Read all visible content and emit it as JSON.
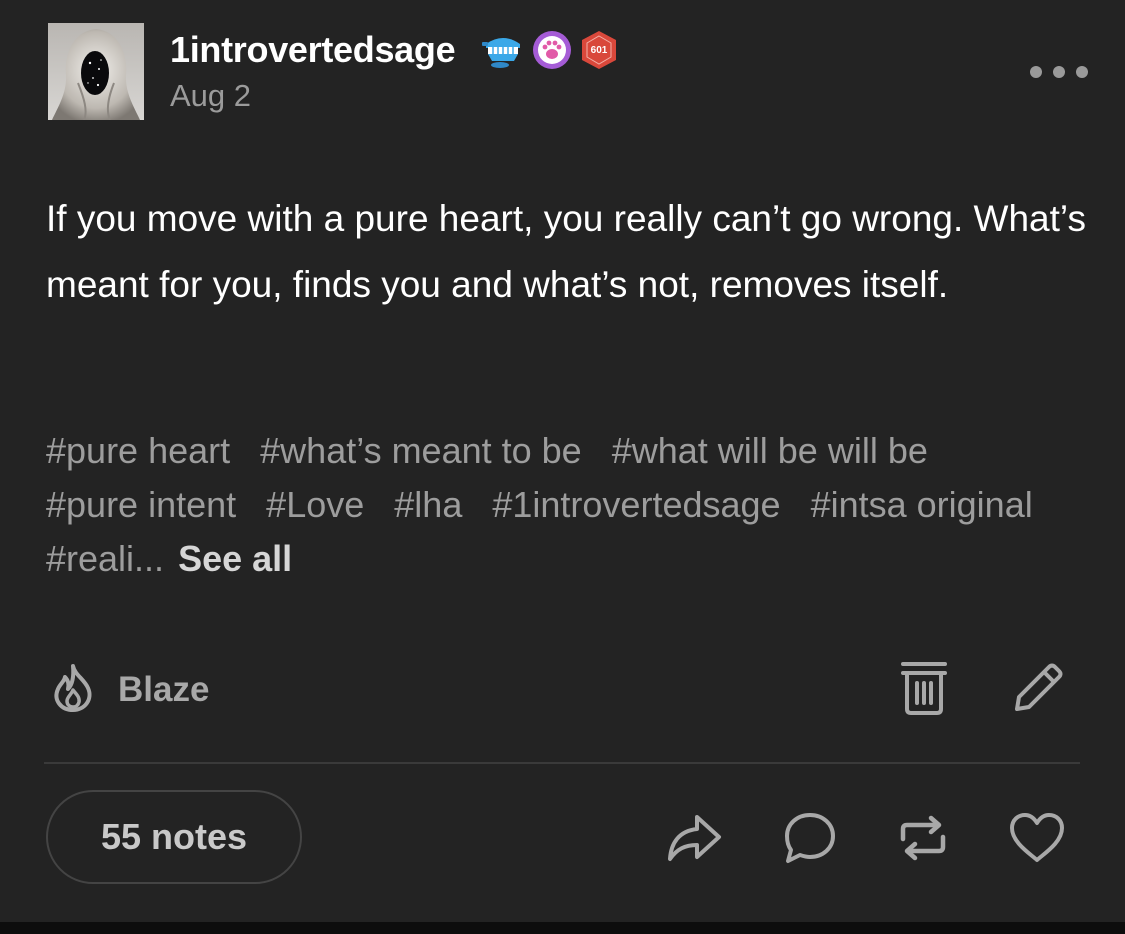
{
  "post": {
    "username": "1introvertedsage",
    "date": "Aug 2",
    "badges": [
      {
        "icon": "teeth-badge-icon",
        "color": "#3aa8e8"
      },
      {
        "icon": "paw-badge-icon",
        "color": "#a55cd6"
      },
      {
        "icon": "hex-601-badge-icon",
        "color": "#d9483b",
        "text": "601"
      }
    ],
    "body": "If you move with a pure heart, you really can’t go wrong. What’s meant for you, finds you and what’s not, removes itself.",
    "tags": [
      "#pure heart",
      "#what’s meant to be",
      "#what will be will be",
      "#pure intent",
      "#Love",
      "#lha",
      "#1introvertedsage",
      "#intsa original",
      "#reali..."
    ],
    "see_all_label": "See all"
  },
  "actions": {
    "blaze_label": "Blaze",
    "delete_icon": "trash-icon",
    "edit_icon": "pencil-icon",
    "notes_label": "55 notes",
    "share_icon": "share-icon",
    "reply_icon": "comment-icon",
    "reblog_icon": "reblog-icon",
    "like_icon": "heart-icon"
  },
  "colors": {
    "background": "#232323",
    "text": "#ffffff",
    "muted": "#9d9d9d",
    "icon": "#a8a8a8"
  }
}
